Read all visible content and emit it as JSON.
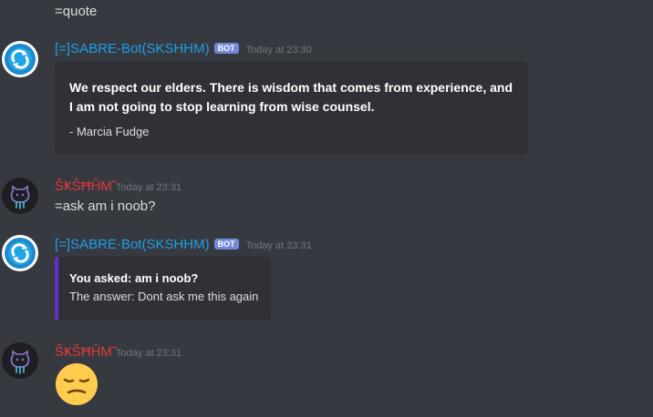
{
  "messages": {
    "top_line": "=quote",
    "bot_name": "[=]SABRE-Bot(SKSHHM)",
    "bot_tag": "BOT",
    "user_name": "ŜҜŜĦĤМ̃",
    "quote_msg": {
      "timestamp": "Today at 23:30",
      "quote": "We respect our elders. There is wisdom that comes from experience, and I am not going to stop learning from wise counsel.",
      "author": "- Marcia Fudge"
    },
    "user_msg_1": {
      "timestamp": "Today at 23:31",
      "text": "=ask am i noob?"
    },
    "ask_msg": {
      "timestamp": "Today at 23:31",
      "question": "You asked: am i noob?",
      "answer": "The answer: Dont ask me this again"
    },
    "user_msg_2": {
      "timestamp": "Today at 23:31",
      "emoji": "unamused-face-emoji"
    }
  },
  "colors": {
    "background": "#36393f",
    "embed_bg": "#2f3136",
    "bot_name": "#1f9ee8",
    "user_name": "#e03a3a",
    "bot_tag": "#7289da",
    "embed_accent": "#6a2ed0",
    "timestamp": "#72767d"
  },
  "icons": {
    "bot_avatar": "bot-refresh-avatar-icon",
    "user_avatar": "octocat-avatar-icon"
  }
}
